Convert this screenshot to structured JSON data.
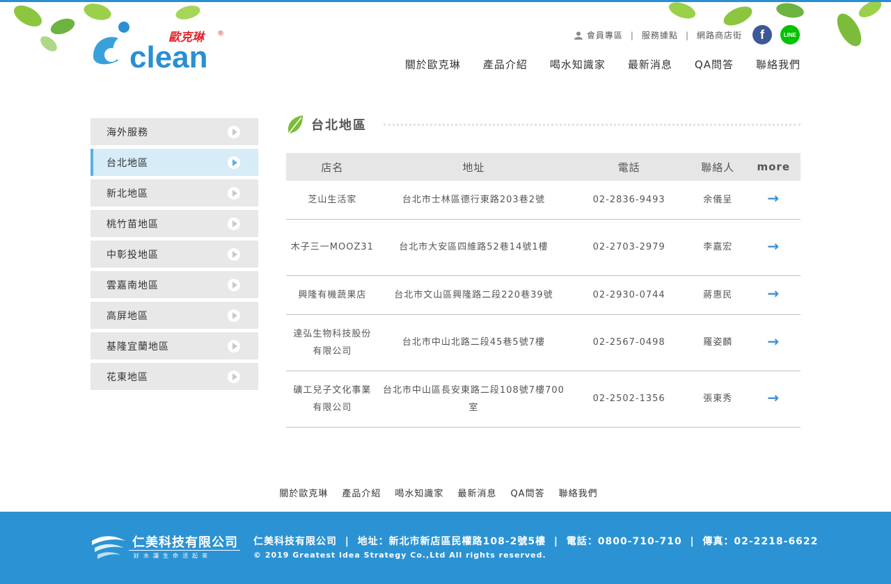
{
  "brand": {
    "logo_text": "clean",
    "logo_cn": "歐克琳",
    "registered": "®"
  },
  "toplinks": {
    "member": "會員專區",
    "service": "服務據點",
    "shop": "網路商店街",
    "sep": "|",
    "facebook_icon": "f",
    "line_icon": "LINE"
  },
  "mainnav": [
    "關於歐克琳",
    "產品介紹",
    "喝水知識家",
    "最新消息",
    "QA問答",
    "聯絡我們"
  ],
  "sidebar": {
    "items": [
      {
        "label": "海外服務"
      },
      {
        "label": "台北地區"
      },
      {
        "label": "新北地區"
      },
      {
        "label": "桃竹苗地區"
      },
      {
        "label": "中彰投地區"
      },
      {
        "label": "雲嘉南地區"
      },
      {
        "label": "高屏地區"
      },
      {
        "label": "基隆宜蘭地區"
      },
      {
        "label": "花東地區"
      }
    ],
    "active_index": 1
  },
  "section": {
    "title": "台北地區"
  },
  "table": {
    "headers": [
      "店名",
      "地址",
      "電話",
      "聯絡人",
      "more"
    ],
    "rows": [
      {
        "name": "芝山生活家",
        "address": "台北市士林區德行東路203巷2號",
        "phone": "02-2836-9493",
        "contact": "余儀呈",
        "more": "→"
      },
      {
        "name": "木子三一MOOZ31",
        "address": "台北市大安區四維路52巷14號1樓",
        "phone": "02-2703-2979",
        "contact": "李嘉宏",
        "more": "→"
      },
      {
        "name": "興隆有機蔬果店",
        "address": "台北市文山區興隆路二段220巷39號",
        "phone": "02-2930-0744",
        "contact": "蔣惠民",
        "more": "→"
      },
      {
        "name": "達弘生物科技股份有限公司",
        "address": "台北市中山北路二段45巷5號7樓",
        "phone": "02-2567-0498",
        "contact": "羅姿麟",
        "more": "→"
      },
      {
        "name": "礦工兒子文化事業有限公司",
        "address": "台北市中山區長安東路二段108號7樓700室",
        "phone": "02-2502-1356",
        "contact": "張東秀",
        "more": "→"
      }
    ]
  },
  "footnav": [
    "關於歐克琳",
    "產品介紹",
    "喝水知識家",
    "最新消息",
    "QA問答",
    "聯絡我們"
  ],
  "footer": {
    "company": "仁美科技有限公司",
    "slogan": "好水讓生命活起來",
    "info": "仁美科技有限公司  |  地址：新北市新店區民權路108-2號5樓  |  電話：0800-710-710  |  傳真：02-2218-6622",
    "copyright": "© 2019 Greatest Idea Strategy Co.,Ltd All rights reserved."
  },
  "colors": {
    "accent": "#2b93d3",
    "active_bg": "#d6ecf7",
    "arrow": "#3b8fd6"
  }
}
